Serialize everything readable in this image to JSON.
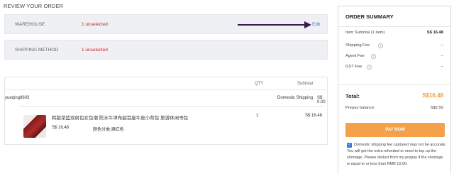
{
  "page": {
    "title": "REVIEW YOUR ORDER"
  },
  "sections": {
    "warehouse": {
      "label": "WAREHOUSE",
      "status": "1 unselected",
      "edit": "Edit"
    },
    "shipping": {
      "label": "SHIPPING METHOD",
      "status": "1 unselected"
    }
  },
  "items": {
    "columns": {
      "qty": "QTY",
      "subtotal": "Subtotal"
    },
    "seller": "yueqing8603",
    "domestic_shipping_label": "Domestic Shipping",
    "domestic_shipping_value": "S$ 0.00",
    "products": [
      {
        "title": "韩版菜篮双肩包女包潮 防水牛津布韶首座牛皮小背包 旅游休闲书包",
        "price": "S$ 16.48",
        "variant": "颜色分类:酒红色",
        "qty": "1",
        "subtotal": "S$ 16.48"
      }
    ]
  },
  "summary": {
    "title": "ORDER SUMMARY",
    "item_subtotal_label": "Item Subtotal",
    "item_subtotal_count": "(1 item)",
    "item_subtotal_value": "S$ 16.48",
    "shipping_fee_label": "Shipping Fee",
    "shipping_fee_value": "--",
    "agent_fee_label": "Agent Fee",
    "agent_fee_value": "--",
    "gst_fee_label": "GST Fee",
    "gst_fee_value": "--",
    "total_label": "Total:",
    "total_value": "S$16.48",
    "prepay_label": "Prepay balance:",
    "prepay_value": "S$2.50",
    "pay_button": "PAY NOW",
    "notice": "Domestic shipping fee captured may not be accurate. You will get the extra refunded or need to top up the shortage. Please deduct from my prepay if the shortage is equal to or less than RMB 10.00."
  },
  "colors": {
    "accent": "#f5a04a",
    "alert": "#e02020",
    "link": "#3a7bd5",
    "total": "#f39c3a"
  }
}
